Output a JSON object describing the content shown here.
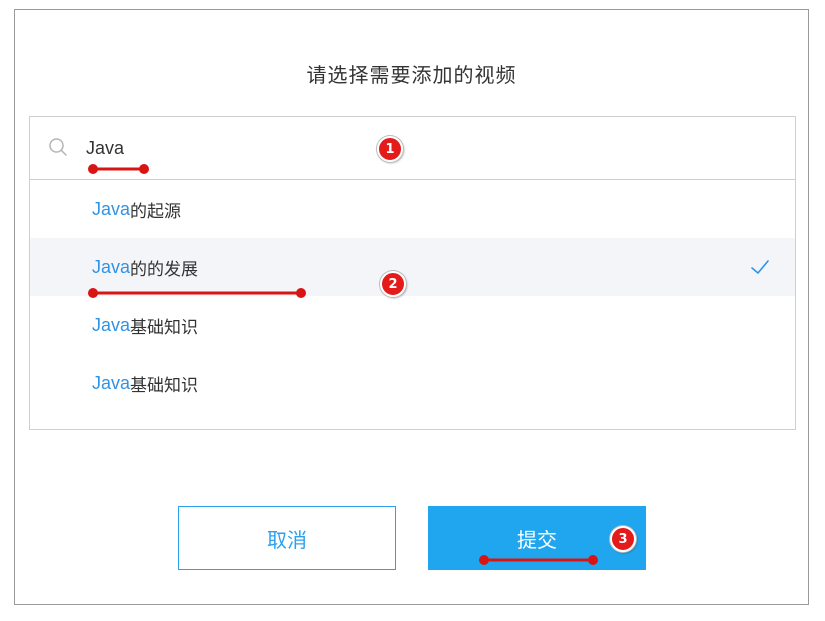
{
  "dialog": {
    "title": "请选择需要添加的视频",
    "search": {
      "value": "Java",
      "placeholder": ""
    },
    "results": [
      {
        "keyword": "Java",
        "rest": "的起源",
        "selected": false
      },
      {
        "keyword": "Java",
        "rest": "的的发展",
        "selected": true
      },
      {
        "keyword": "Java",
        "rest": "基础知识",
        "selected": false
      },
      {
        "keyword": "Java",
        "rest": "基础知识",
        "selected": false
      }
    ],
    "cancel_label": "取消",
    "submit_label": "提交"
  },
  "annotations": {
    "marker_1": "1",
    "marker_2": "2",
    "marker_3": "3"
  },
  "colors": {
    "accent": "#20a6ef",
    "keyword": "#2f93e6",
    "annotation": "#e41b1b",
    "selected_row": "#f4f5f9"
  },
  "icons": {
    "search": "search-icon",
    "selected": "check-icon"
  }
}
